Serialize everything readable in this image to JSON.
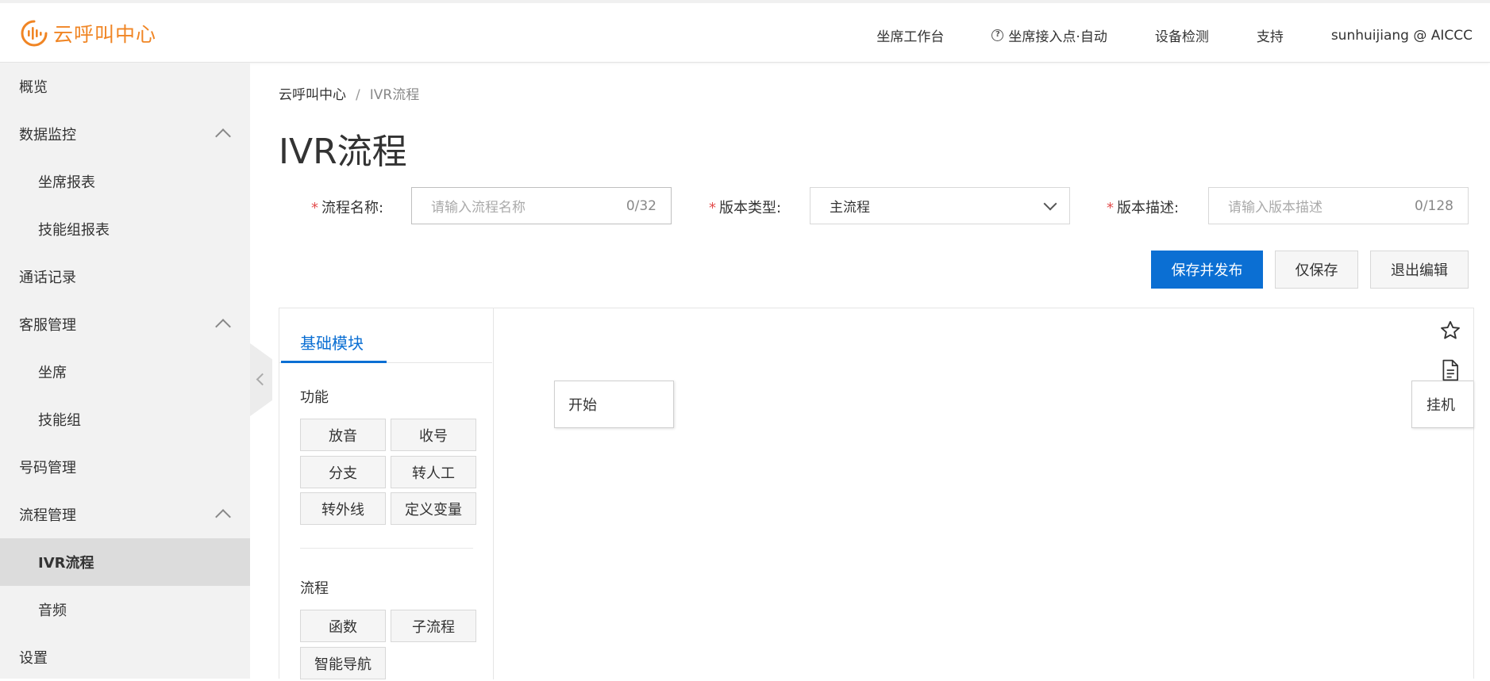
{
  "app": {
    "title": "云呼叫中心",
    "brand_color": "#f08524"
  },
  "topnav": {
    "items": [
      "坐席工作台",
      "坐席接入点·自动",
      "设备检测",
      "支持",
      "sunhuijiang @ AICCC"
    ]
  },
  "sidebar": {
    "items": [
      {
        "label": "概览"
      },
      {
        "label": "数据监控"
      },
      {
        "label": "坐席报表"
      },
      {
        "label": "技能组报表"
      },
      {
        "label": "通话记录"
      },
      {
        "label": "客服管理"
      },
      {
        "label": "坐席"
      },
      {
        "label": "技能组"
      },
      {
        "label": "号码管理"
      },
      {
        "label": "流程管理"
      },
      {
        "label": "IVR流程"
      },
      {
        "label": "音频"
      },
      {
        "label": "设置"
      }
    ]
  },
  "breadcrumb": {
    "root": "云呼叫中心",
    "sep": "/",
    "current": "IVR流程"
  },
  "page": {
    "title": "IVR流程"
  },
  "form": {
    "flow_name": {
      "label": "流程名称:",
      "placeholder": "请输入流程名称",
      "count": "0/32"
    },
    "version_type": {
      "label": "版本类型:",
      "value": "主流程"
    },
    "version_desc": {
      "label": "版本描述:",
      "placeholder": "请输入版本描述",
      "count": "0/128"
    },
    "required_mark": "*"
  },
  "actions": {
    "publish": "保存并发布",
    "save": "仅保存",
    "exit": "退出编辑",
    "primary_color": "#0b6fd3"
  },
  "palette": {
    "tab": "基础模块",
    "groups": {
      "function": {
        "title": "功能",
        "modules": [
          "放音",
          "收号",
          "分支",
          "转人工",
          "转外线",
          "定义变量"
        ]
      },
      "flow": {
        "title": "流程",
        "modules": [
          "函数",
          "子流程",
          "智能导航"
        ]
      }
    }
  },
  "canvas": {
    "start_node": "开始",
    "hangup_node": "挂机",
    "icons": [
      "star-icon",
      "document-icon"
    ]
  }
}
